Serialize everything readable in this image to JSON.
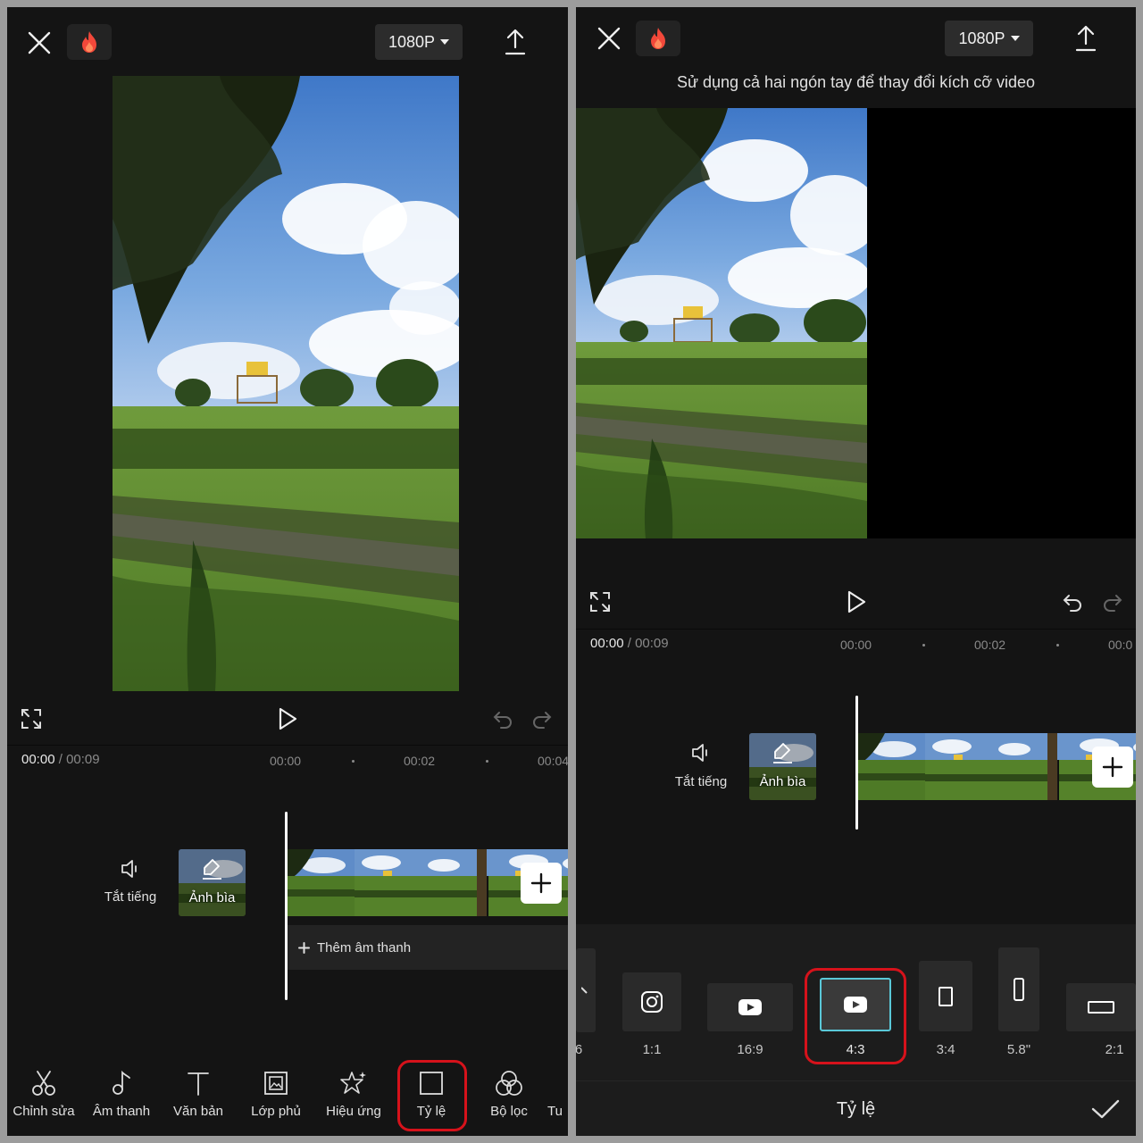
{
  "left": {
    "resolution": "1080P",
    "time": {
      "current": "00:00",
      "separator": "/",
      "total": "00:09"
    },
    "ticks": [
      "00:00",
      "00:02",
      "00:04"
    ],
    "mute_label": "Tắt tiếng",
    "cover_label": "Ảnh bìa",
    "add_audio_label": "Thêm âm thanh",
    "toolbar": [
      {
        "label": "Chỉnh sửa",
        "icon": "scissors-icon"
      },
      {
        "label": "Âm thanh",
        "icon": "music-note-icon"
      },
      {
        "label": "Văn bản",
        "icon": "text-icon"
      },
      {
        "label": "Lớp phủ",
        "icon": "overlay-icon"
      },
      {
        "label": "Hiệu ứng",
        "icon": "effects-star-icon"
      },
      {
        "label": "Tỷ lệ",
        "icon": "ratio-square-icon",
        "highlighted": true
      },
      {
        "label": "Bộ lọc",
        "icon": "filter-icon"
      },
      {
        "label": "Tu",
        "icon": ""
      }
    ]
  },
  "right": {
    "resolution": "1080P",
    "hint": "Sử dụng cả hai ngón tay để thay đổi kích cỡ video",
    "time": {
      "current": "00:00",
      "separator": "/",
      "total": "00:09"
    },
    "ticks": [
      "00:00",
      "00:02",
      "00:0"
    ],
    "mute_label": "Tắt tiếng",
    "cover_label": "Ảnh bìa",
    "ratios": [
      {
        "label": "6",
        "partial": true
      },
      {
        "label": "1:1",
        "icon": "instagram-icon"
      },
      {
        "label": "16:9",
        "icon": "youtube-icon"
      },
      {
        "label": "4:3",
        "icon": "youtube-icon",
        "selected": true
      },
      {
        "label": "3:4",
        "icon": "portrait-icon"
      },
      {
        "label": "5.8\"",
        "icon": "phone-icon"
      },
      {
        "label": "2:1",
        "icon": "landscape-icon"
      }
    ],
    "panel_title": "Tỷ lệ",
    "accent_color": "#5ac8d8",
    "highlight_color": "#d6121b"
  }
}
